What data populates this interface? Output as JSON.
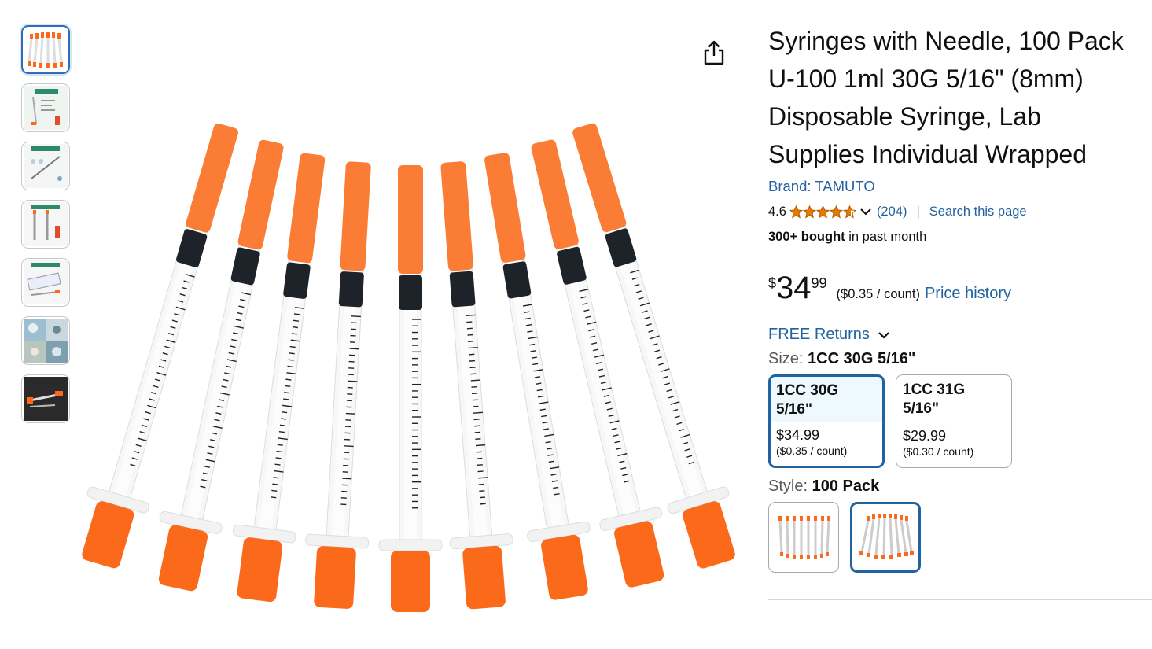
{
  "colors": {
    "link": "#2162a1",
    "selected_border": "#2162a1",
    "star": "#e67a00",
    "syringe_orange": "#fb6a1a"
  },
  "thumbnails": [
    {
      "icon": "syringe-fan-thumbnail",
      "active": true
    },
    {
      "icon": "infographic-thumbnail",
      "active": false
    },
    {
      "icon": "instructions-thumbnail",
      "active": false
    },
    {
      "icon": "scale-detail-thumbnail",
      "active": false
    },
    {
      "icon": "packaging-thumbnail",
      "active": false
    },
    {
      "icon": "lab-collage-thumbnail",
      "active": false
    },
    {
      "icon": "dark-product-thumbnail",
      "active": false
    }
  ],
  "main_image": {
    "icon": "syringes-product-image"
  },
  "share": {
    "icon": "share-icon"
  },
  "product": {
    "title": "Syringes with Needle, 100 Pack U-100 1ml 30G 5/16\" (8mm) Disposable Syringe, Lab Supplies Individual Wrapped",
    "brand": "Brand: TAMUTO",
    "rating": "4.6",
    "rating_value": 4.6,
    "reviews": "(204)",
    "separator": "|",
    "search_page": "Search this page",
    "bought_bold": "300+ bought",
    "bought_rest": " in past month"
  },
  "price": {
    "symbol": "$",
    "whole": "34",
    "fraction": "99",
    "unit": "($0.35 / count)",
    "history": "Price history"
  },
  "returns": {
    "label": "FREE Returns",
    "icon": "chevron-down-icon"
  },
  "size": {
    "label": "Size: ",
    "selected": "1CC 30G 5/16\"",
    "options": [
      {
        "name": "1CC 30G 5/16\"",
        "price": "$34.99",
        "unit": "($0.35 / count)",
        "selected": true
      },
      {
        "name": "1CC 31G 5/16\"",
        "price": "$29.99",
        "unit": "($0.30 / count)",
        "selected": false
      }
    ]
  },
  "style": {
    "label": "Style: ",
    "selected": "100 Pack",
    "options": [
      {
        "icon": "syringe-row-swatch",
        "selected": false
      },
      {
        "icon": "syringe-fan-swatch",
        "selected": true
      }
    ]
  }
}
